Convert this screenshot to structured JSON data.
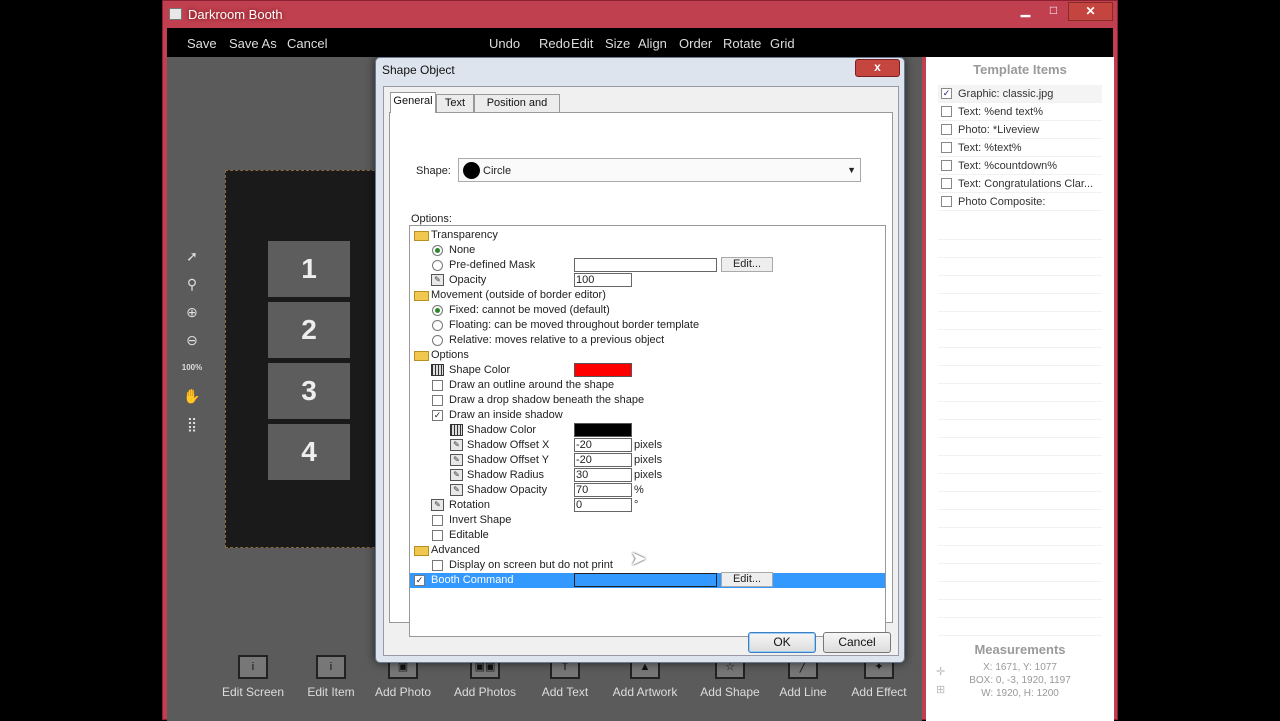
{
  "window": {
    "title": "Darkroom Booth",
    "minimize": "▁",
    "maximize": "□",
    "close": "✕"
  },
  "menu": {
    "left": [
      "Save",
      "Save As",
      "Cancel"
    ],
    "center": [
      "Undo",
      "Redo",
      "Edit",
      "Size",
      "Align",
      "Order",
      "Rotate",
      "Grid"
    ]
  },
  "tools": {
    "zoom_label": "100%"
  },
  "slots": [
    "1",
    "2",
    "3",
    "4"
  ],
  "bottom_toolbar": [
    "Edit Screen",
    "Edit Item",
    "Add Photo",
    "Add Photos",
    "Add Text",
    "Add Artwork",
    "Add Shape",
    "Add Line",
    "Add Effect"
  ],
  "template_items": {
    "title": "Template Items",
    "items": [
      {
        "label": "Graphic: classic.jpg",
        "checked": true
      },
      {
        "label": "Text: %end text%",
        "checked": false
      },
      {
        "label": "Photo: *Liveview",
        "checked": false
      },
      {
        "label": "Text: %text%",
        "checked": false
      },
      {
        "label": "Text: %countdown%",
        "checked": false
      },
      {
        "label": "Text: Congratulations Clar...",
        "checked": false
      },
      {
        "label": "Photo Composite:",
        "checked": false
      }
    ]
  },
  "measurements": {
    "title": "Measurements",
    "xy": "X: 1671, Y: 1077",
    "box": "BOX: 0, -3, 1920, 1197",
    "wh": "W: 1920, H: 1200"
  },
  "dialog": {
    "title": "Shape Object",
    "close": "x",
    "tabs": [
      "General",
      "Text",
      "Position and Size"
    ],
    "shape_label": "Shape:",
    "shape_value": "Circle",
    "options_label": "Options:",
    "tree": {
      "transparency": "Transparency",
      "none": "None",
      "mask": "Pre-defined Mask",
      "edit": "Edit...",
      "opacity": "Opacity",
      "opacity_value": "100",
      "movement": "Movement  (outside of border editor)",
      "fixed": "Fixed:  cannot be moved (default)",
      "floating": "Floating:  can be moved throughout border template",
      "relative": "Relative:  moves relative to a previous object",
      "options": "Options",
      "shape_color": "Shape Color",
      "outline": "Draw an outline around the shape",
      "drop_shadow": "Draw a drop shadow beneath the shape",
      "inside_shadow": "Draw an inside shadow",
      "shadow_color": "Shadow Color",
      "offset_x": "Shadow Offset X",
      "offset_x_value": "-20",
      "offset_y": "Shadow Offset Y",
      "offset_y_value": "-20",
      "radius": "Shadow Radius",
      "radius_value": "30",
      "shadow_opacity": "Shadow Opacity",
      "shadow_opacity_value": "70",
      "pixels": "pixels",
      "percent": "%",
      "rotation": "Rotation",
      "rotation_value": "0",
      "degree": "°",
      "invert": "Invert Shape",
      "editable": "Editable",
      "advanced": "Advanced",
      "display_only": "Display on screen but do not print",
      "booth_command": "Booth Command"
    },
    "ok": "OK",
    "cancel": "Cancel"
  },
  "colors": {
    "shape_color": "#ff0000",
    "shadow_color": "#000000",
    "selection": "#3399ff"
  }
}
